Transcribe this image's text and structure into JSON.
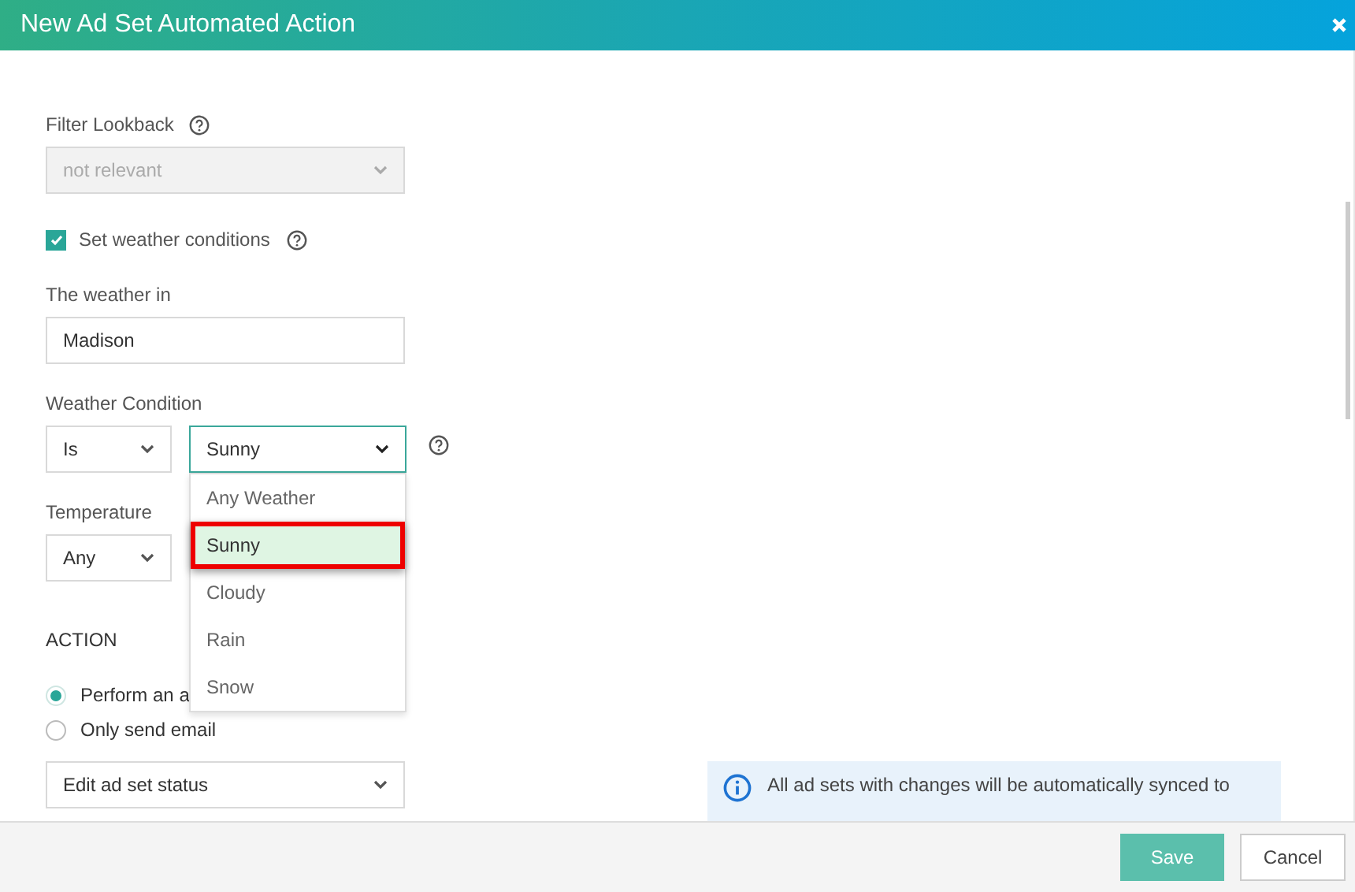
{
  "window": {
    "title": "New Ad Set Automated Action"
  },
  "filter_lookback": {
    "label": "Filter Lookback",
    "value": "not relevant",
    "disabled": true
  },
  "weather_conditions": {
    "label": "Set weather conditions",
    "checked": true
  },
  "weather_in": {
    "label": "The weather in",
    "value": "Madison"
  },
  "weather_condition": {
    "label": "Weather Condition",
    "operator": "Is",
    "value": "Sunny",
    "expanded": true,
    "options": [
      {
        "label": "Any Weather",
        "selected": false
      },
      {
        "label": "Sunny",
        "selected": true
      },
      {
        "label": "Cloudy",
        "selected": false
      },
      {
        "label": "Rain",
        "selected": false
      },
      {
        "label": "Snow",
        "selected": false
      }
    ]
  },
  "temperature": {
    "label": "Temperature",
    "value": "Any"
  },
  "action": {
    "heading": "ACTION",
    "options": [
      {
        "label": "Perform an a",
        "selected": true
      },
      {
        "label": "Only send email",
        "selected": false
      }
    ],
    "select": "Edit ad set status"
  },
  "info": "All ad sets with changes will be automatically synced to",
  "buttons": [
    {
      "label": "Save",
      "kind": "primary"
    },
    {
      "label": "Cancel",
      "kind": "secondary"
    }
  ]
}
